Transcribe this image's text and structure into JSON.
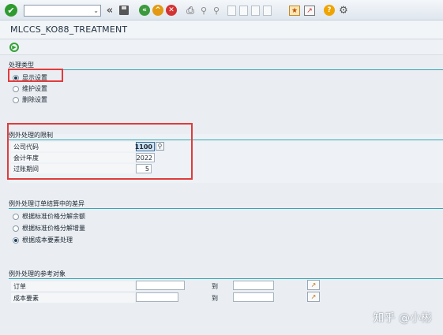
{
  "window": {
    "title": "MLCCS_KO88_TREATMENT"
  },
  "toolbar": {
    "command_value": "",
    "icons": [
      "check-icon",
      "back-double-arrow-icon",
      "save-icon",
      "back-icon",
      "exit-icon",
      "cancel-icon",
      "print-icon",
      "find-icon",
      "find-next-icon",
      "first-page-icon",
      "previous-page-icon",
      "next-page-icon",
      "last-page-icon",
      "new-session-icon",
      "shortcut-icon",
      "help-icon",
      "settings-gear-icon"
    ]
  },
  "app_toolbar": {
    "execute_icon": "execute-icon"
  },
  "processing_type": {
    "title": "处理类型",
    "options": [
      {
        "label": "显示设置",
        "selected": true
      },
      {
        "label": "维护设置",
        "selected": false
      },
      {
        "label": "删除设置",
        "selected": false
      }
    ]
  },
  "restrictions": {
    "title": "例外处理的限制",
    "fields": [
      {
        "label": "公司代码",
        "value": "1100"
      },
      {
        "label": "会计年度",
        "value": "2022"
      },
      {
        "label": "过账期间",
        "value": "5"
      }
    ]
  },
  "variance": {
    "title": "例外处理订单结算中的差异",
    "options": [
      {
        "label": "根据标准价格分解余额",
        "selected": false
      },
      {
        "label": "根据标准价格分解增量",
        "selected": false
      },
      {
        "label": "根据成本要素处理",
        "selected": true
      }
    ]
  },
  "reference": {
    "title": "例外处理的参考对象",
    "rows": [
      {
        "label": "订单",
        "from": "",
        "to_label": "到",
        "to": ""
      },
      {
        "label": "成本要素",
        "from": "",
        "to_label": "到",
        "to": ""
      }
    ]
  },
  "watermark": "知乎 @小彬"
}
